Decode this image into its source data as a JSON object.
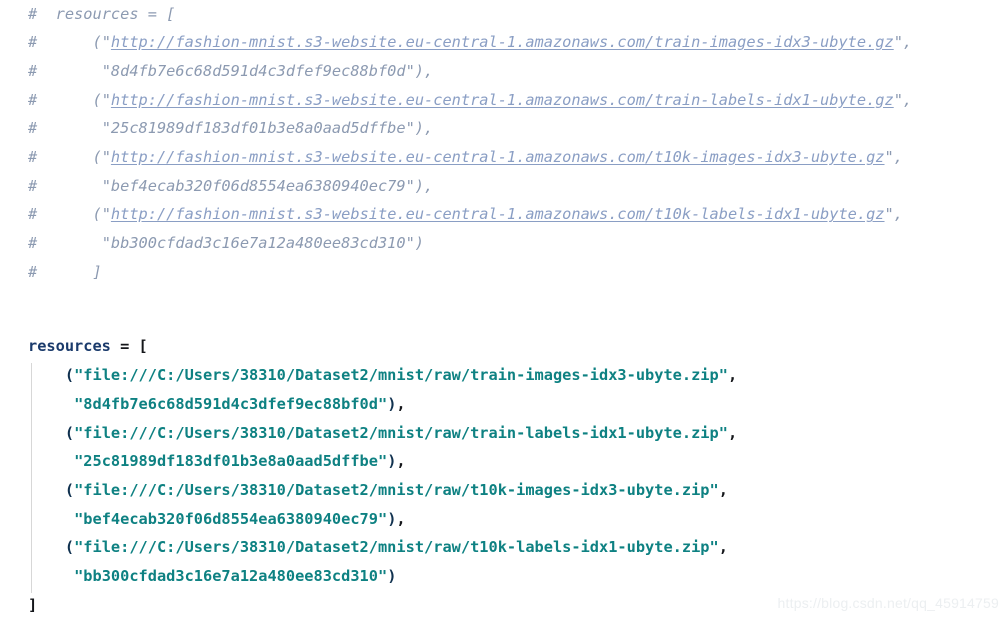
{
  "editor": {
    "background_color": "#ffffff",
    "comment_color": "#8c9ab1",
    "link_color": "#8a9ec4",
    "string_color": "#0e8182",
    "name_color": "#1a3a6b",
    "punct_color": "#14161a",
    "indent_guide_color": "#d7d7d7"
  },
  "commented_block": {
    "hash": "#",
    "lines": [
      {
        "indent": "  ",
        "before": "resources = [",
        "link": "",
        "after": ""
      },
      {
        "indent": "      ",
        "before": "(\"",
        "link": "http://fashion-mnist.s3-website.eu-central-1.amazonaws.com/train-images-idx3-ubyte.gz",
        "after": "\","
      },
      {
        "indent": "       ",
        "before": "\"8d4fb7e6c68d591d4c3dfef9ec88bf0d\"),",
        "link": "",
        "after": ""
      },
      {
        "indent": "      ",
        "before": "(\"",
        "link": "http://fashion-mnist.s3-website.eu-central-1.amazonaws.com/train-labels-idx1-ubyte.gz",
        "after": "\","
      },
      {
        "indent": "       ",
        "before": "\"25c81989df183df01b3e8a0aad5dffbe\"),",
        "link": "",
        "after": ""
      },
      {
        "indent": "      ",
        "before": "(\"",
        "link": "http://fashion-mnist.s3-website.eu-central-1.amazonaws.com/t10k-images-idx3-ubyte.gz",
        "after": "\","
      },
      {
        "indent": "       ",
        "before": "\"bef4ecab320f06d8554ea6380940ec79\"),",
        "link": "",
        "after": ""
      },
      {
        "indent": "      ",
        "before": "(\"",
        "link": "http://fashion-mnist.s3-website.eu-central-1.amazonaws.com/t10k-labels-idx1-ubyte.gz",
        "after": "\","
      },
      {
        "indent": "       ",
        "before": "\"bb300cfdad3c16e7a12a480ee83cd310\")",
        "link": "",
        "after": ""
      },
      {
        "indent": "      ",
        "before": "]",
        "link": "",
        "after": ""
      }
    ]
  },
  "source_block": {
    "open_statement": {
      "name": "resources",
      "equals": " = ",
      "bracket": "["
    },
    "entries": [
      {
        "indent": "    ",
        "open": "(",
        "url": "\"file:///C:/Users/38310/Dataset2/mnist/raw/train-images-idx3-ubyte.zip\"",
        "url_comma": ",",
        "hash_indent": "     ",
        "hash": "\"8d4fb7e6c68d591d4c3dfef9ec88bf0d\"",
        "close": ")",
        "trailing": ","
      },
      {
        "indent": "    ",
        "open": "(",
        "url": "\"file:///C:/Users/38310/Dataset2/mnist/raw/train-labels-idx1-ubyte.zip\"",
        "url_comma": ",",
        "hash_indent": "     ",
        "hash": "\"25c81989df183df01b3e8a0aad5dffbe\"",
        "close": ")",
        "trailing": ","
      },
      {
        "indent": "    ",
        "open": "(",
        "url": "\"file:///C:/Users/38310/Dataset2/mnist/raw/t10k-images-idx3-ubyte.zip\"",
        "url_comma": ",",
        "hash_indent": "     ",
        "hash": "\"bef4ecab320f06d8554ea6380940ec79\"",
        "close": ")",
        "trailing": ","
      },
      {
        "indent": "    ",
        "open": "(",
        "url": "\"file:///C:/Users/38310/Dataset2/mnist/raw/t10k-labels-idx1-ubyte.zip\"",
        "url_comma": ",",
        "hash_indent": "     ",
        "hash": "\"bb300cfdad3c16e7a12a480ee83cd310\"",
        "close": ")",
        "trailing": ""
      }
    ],
    "close_bracket": "]"
  },
  "watermark": {
    "text": "https://blog.csdn.net/qq_45914759"
  }
}
